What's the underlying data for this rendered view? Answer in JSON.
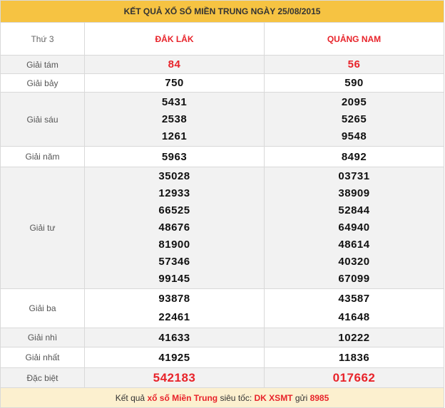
{
  "header": {
    "title": "KẾT QUẢ XỔ SỐ MIỀN TRUNG NGÀY 25/08/2015"
  },
  "columns": {
    "day": "Thứ 3",
    "province_1": "ĐẮK LẮK",
    "province_2": "QUẢNG NAM"
  },
  "prizes": [
    {
      "label": "Giải tám",
      "p1": [
        "84"
      ],
      "p2": [
        "56"
      ]
    },
    {
      "label": "Giải bảy",
      "p1": [
        "750"
      ],
      "p2": [
        "590"
      ]
    },
    {
      "label": "Giải sáu",
      "p1": [
        "5431",
        "2538",
        "1261"
      ],
      "p2": [
        "2095",
        "5265",
        "9548"
      ]
    },
    {
      "label": "Giải năm",
      "p1": [
        "5963"
      ],
      "p2": [
        "8492"
      ]
    },
    {
      "label": "Giải tư",
      "p1": [
        "35028",
        "12933",
        "66525",
        "48676",
        "81900",
        "57346",
        "99145"
      ],
      "p2": [
        "03731",
        "38909",
        "52844",
        "64940",
        "48614",
        "40320",
        "67099"
      ]
    },
    {
      "label": "Giải ba",
      "p1": [
        "93878",
        "22461"
      ],
      "p2": [
        "43587",
        "41648"
      ]
    },
    {
      "label": "Giải nhì",
      "p1": [
        "41633"
      ],
      "p2": [
        "10222"
      ]
    },
    {
      "label": "Giải nhất",
      "p1": [
        "41925"
      ],
      "p2": [
        "11836"
      ]
    },
    {
      "label": "Đặc biệt",
      "p1": [
        "542183"
      ],
      "p2": [
        "017662"
      ]
    }
  ],
  "footer": {
    "prefix": "Kết quả",
    "link": "xổ số Miền Trung",
    "middle": "siêu tốc:",
    "sms_code": "DK XSMT",
    "send": "gửi",
    "number": "8985"
  },
  "colors": {
    "header_bg": "#f6c342",
    "accent_red": "#e8232a",
    "row_gray": "#f2f2f2",
    "footer_bg": "#fcf0cf"
  }
}
